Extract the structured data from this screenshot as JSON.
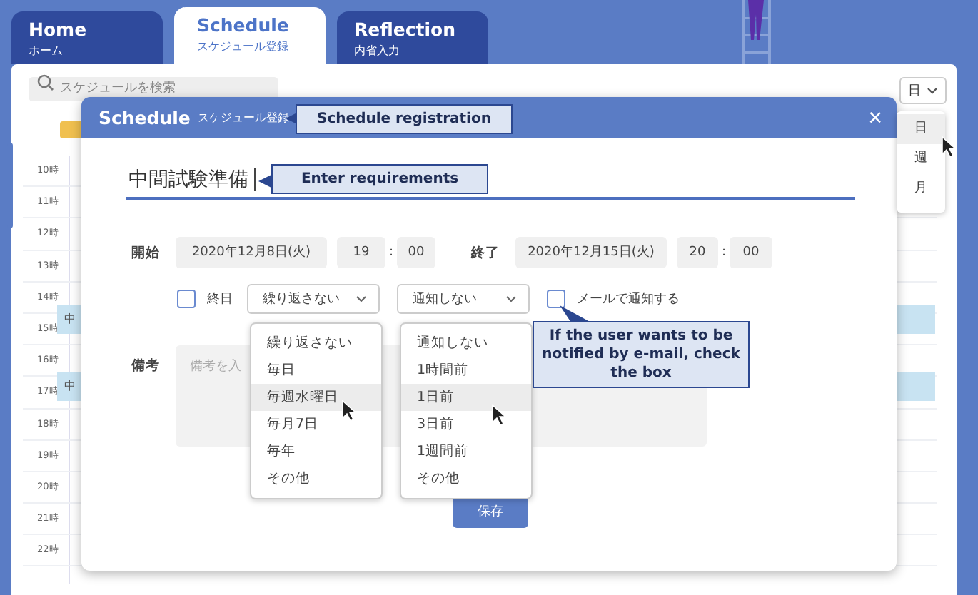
{
  "tabs": [
    {
      "label": "Home",
      "sublabel": "ホーム",
      "selected": false
    },
    {
      "label": "Schedule",
      "sublabel": "スケジュール登録",
      "selected": true
    },
    {
      "label": "Reflection",
      "sublabel": "内省入力",
      "selected": false
    }
  ],
  "search": {
    "placeholder": "スケジュールを検索"
  },
  "view_select": {
    "value": "日",
    "options": [
      {
        "label": "日",
        "selected": true
      },
      {
        "label": "週",
        "selected": false
      },
      {
        "label": "月",
        "selected": false
      }
    ]
  },
  "time_labels": [
    "10時",
    "11時",
    "12時",
    "13時",
    "14時",
    "15時",
    "16時",
    "17時",
    "18時",
    "19時",
    "20時",
    "21時",
    "22時"
  ],
  "events": [
    {
      "label": "中"
    },
    {
      "label": "中"
    }
  ],
  "modal": {
    "title": "Schedule",
    "subtitle": "スケジュール登録",
    "close": "×",
    "title_field": {
      "value": "中間試験準備"
    },
    "start": {
      "label": "開始",
      "date": "2020年12月8日(火)",
      "hour": "19",
      "separator": ":",
      "minute": "00"
    },
    "end": {
      "label": "終了",
      "date": "2020年12月15日(火)",
      "hour": "20",
      "separator": ":",
      "minute": "00"
    },
    "all_day": {
      "label": "終日",
      "checked": false
    },
    "repeat_select": {
      "value": "繰り返さない",
      "options": [
        {
          "label": "繰り返さない",
          "hovered": false
        },
        {
          "label": "毎日",
          "hovered": false
        },
        {
          "label": "毎週水曜日",
          "hovered": true
        },
        {
          "label": "毎月7日",
          "hovered": false
        },
        {
          "label": "毎年",
          "hovered": false
        },
        {
          "label": "その他",
          "hovered": false
        }
      ]
    },
    "notify_select": {
      "value": "通知しない",
      "options": [
        {
          "label": "通知しない",
          "hovered": false
        },
        {
          "label": "1時間前",
          "hovered": false
        },
        {
          "label": "1日前",
          "hovered": true
        },
        {
          "label": "3日前",
          "hovered": false
        },
        {
          "label": "1週間前",
          "hovered": false
        },
        {
          "label": "その他",
          "hovered": false
        }
      ]
    },
    "email_notify": {
      "label": "メールで通知する",
      "checked": false
    },
    "memo": {
      "label": "備考",
      "placeholder": "備考を入"
    },
    "save_button": "保存"
  },
  "callouts": [
    {
      "text": "Schedule registration"
    },
    {
      "text": "Enter requirements"
    },
    {
      "text": "If the user wants to be notified by e-mail, check the box"
    }
  ]
}
